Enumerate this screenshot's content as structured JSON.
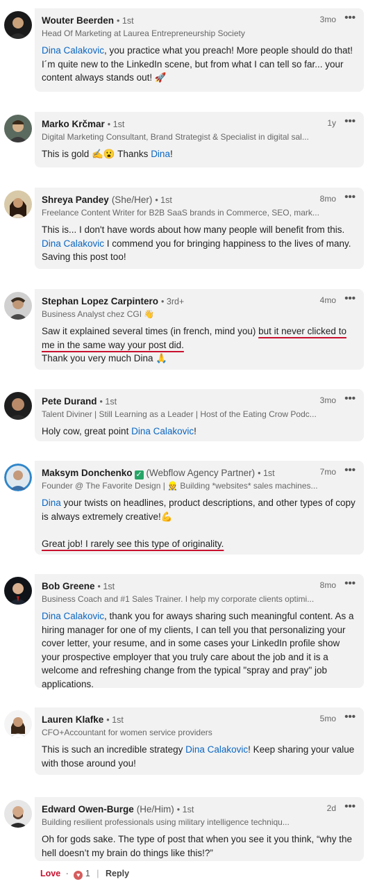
{
  "more_icon": "•••",
  "comments": [
    {
      "name": "Wouter Beerden",
      "degree": "• 1st",
      "time": "3mo",
      "headline": "Head Of Marketing at Laurea Entrepreneurship Society",
      "mention": "Dina Calakovic",
      "text": ", you practice what you preach! More people should do that! I´m quite new to the LinkedIn scene, but from what I can tell so far... your content always stands out! 🚀"
    },
    {
      "name": "Marko Krčmar",
      "degree": "• 1st",
      "time": "1y",
      "headline": "Digital Marketing Consultant, Brand Strategist & Specialist in digital sal...",
      "text_a": "This is gold ✍️😮 Thanks ",
      "mention": "Dina",
      "text_b": "!"
    },
    {
      "name": "Shreya Pandey",
      "pronouns": "(She/Her)",
      "degree": "• 1st",
      "time": "8mo",
      "headline": "Freelance Content Writer for B2B SaaS brands in Commerce, SEO, mark...",
      "text_a": "This is... I don't have words about how many people will benefit from this. ",
      "mention": "Dina Calakovic",
      "text_b": " I commend you for bringing happiness to the lives of many. Saving this post too!"
    },
    {
      "name": "Stephan Lopez Carpintero",
      "degree": "• 3rd+",
      "time": "4mo",
      "headline": "Business Analyst chez CGI 👋",
      "text_a": "Saw it explained several times (in french, mind you) ",
      "text_ul": "but it never clicked to me in the same way your post did.",
      "text_b": "Thank you very much Dina 🙏"
    },
    {
      "name": "Pete Durand",
      "degree": "• 1st",
      "time": "3mo",
      "headline": "Talent Diviner | Still Learning as a Leader | Host of the Eating Crow Podc...",
      "text_a": "Holy cow, great point ",
      "mention": "Dina Calakovic",
      "text_b": "!"
    },
    {
      "name": "Maksym Donchenko",
      "verified": "✓",
      "pronouns": "(Webflow Agency Partner)",
      "degree": "• 1st",
      "time": "7mo",
      "headline": "Founder @ The Favorite Design | 👷 Building *websites* sales machines...",
      "mention": "Dina",
      "text_a": " your twists on headlines, product descriptions, and other types of copy is always extremely creative!💪",
      "text_ul": "Great job! I rarely see this type of originality."
    },
    {
      "name": "Bob Greene",
      "degree": "• 1st",
      "time": "8mo",
      "headline": "Business Coach and #1 Sales Trainer. I help my corporate clients optimi...",
      "mention": "Dina Calakovic",
      "text": ", thank you for aways sharing such meaningful content. As a hiring manager for one of my clients, I can tell you that personalizing your cover letter, your resume, and in some cases your LinkedIn profile show your prospective employer that you truly care about the job and it is a welcome and refreshing change from the typical \"spray and pray\" job applications."
    },
    {
      "name": "Lauren Klafke",
      "degree": "• 1st",
      "time": "5mo",
      "headline": "CFO+Accountant for women service providers",
      "text_a": "This is such an incredible strategy ",
      "mention": "Dina Calakovic",
      "text_b": "! Keep sharing your value with those around you!"
    },
    {
      "name": "Edward Owen-Burge",
      "pronouns": "(He/Him)",
      "degree": "• 1st",
      "time": "2d",
      "headline": "Building resilient professionals using military intelligence techniqu...",
      "text": "Oh for gods sake. The type of post that when you see it you think, “why the hell doesn’t my brain do things like this!?”"
    }
  ],
  "actions": {
    "love": "Love",
    "dot": "·",
    "count": "1",
    "sep": "|",
    "reply": "Reply",
    "heart_icon": "♥"
  }
}
